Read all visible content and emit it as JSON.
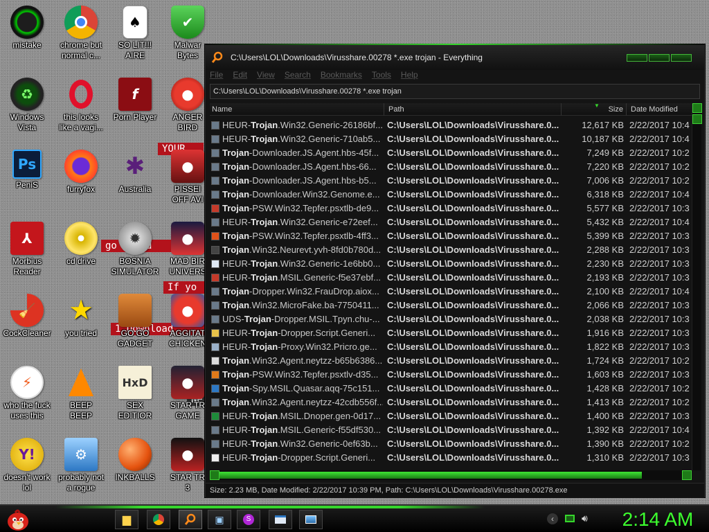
{
  "desktop": {
    "icons": [
      {
        "label": "mistake"
      },
      {
        "label": "chrome but\nnormal c..."
      },
      {
        "label": "SO LIT!!!\nAIRE"
      },
      {
        "label": "Malwar\nBytes"
      },
      {
        "label": "Windows\nVista"
      },
      {
        "label": "this looks\nlike a vagi..."
      },
      {
        "label": "Porn Player"
      },
      {
        "label": "ANGER\nBIRD"
      },
      {
        "label": "PeniS"
      },
      {
        "label": "furryfox"
      },
      {
        "label": "Australia"
      },
      {
        "label": "PISSEI\nOFF AVI"
      },
      {
        "label": "Morbius\nReader"
      },
      {
        "label": "cd drive"
      },
      {
        "label": "BOSNIA\nSIMULATOR"
      },
      {
        "label": "MAD BIR\nUNIVERS"
      },
      {
        "label": "CockCleaner"
      },
      {
        "label": "you tried"
      },
      {
        "label": "GO GO\nGADGET"
      },
      {
        "label": "AGGITAT\nCHICKEN"
      },
      {
        "label": "who the fuck\nuses this"
      },
      {
        "label": "BEEP\nBEEP"
      },
      {
        "label": "SEX\nEDITIOR"
      },
      {
        "label": "STAR TR\nGAME"
      },
      {
        "label": "doesn't work\nlol"
      },
      {
        "label": "probably not\na rogue"
      },
      {
        "label": "INKBALLS"
      },
      {
        "label": "STAR TR\n3"
      }
    ],
    "strips": [
      {
        "text": "YOUR"
      },
      {
        "text": "go   any   d"
      },
      {
        "text": "If yo"
      },
      {
        "text": "1  Download"
      },
      {
        "text": "Ne"
      }
    ]
  },
  "window": {
    "title": "C:\\Users\\LOL\\Downloads\\Virusshare.00278 *.exe trojan - Everything",
    "menu": [
      "File",
      "Edit",
      "View",
      "Search",
      "Bookmarks",
      "Tools",
      "Help"
    ],
    "search_value": "C:\\Users\\LOL\\Downloads\\Virusshare.00278 *.exe trojan",
    "columns": {
      "name": "Name",
      "path": "Path",
      "size": "Size",
      "date": "Date Modified"
    },
    "rows": [
      {
        "pre": "HEUR-",
        "hl": "Trojan",
        "post": ".Win32.Generic-26186bf...",
        "path": "C:\\Users\\LOL\\Downloads\\Virusshare.0...",
        "size": "12,617 KB",
        "date": "2/22/2017 10:4"
      },
      {
        "pre": "HEUR-",
        "hl": "Trojan",
        "post": ".Win32.Generic-710ab5...",
        "path": "C:\\Users\\LOL\\Downloads\\Virusshare.0...",
        "size": "10,187 KB",
        "date": "2/22/2017 10:4"
      },
      {
        "pre": "",
        "hl": "Trojan",
        "post": "-Downloader.JS.Agent.hbs-45f...",
        "path": "C:\\Users\\LOL\\Downloads\\Virusshare.0...",
        "size": "7,249 KB",
        "date": "2/22/2017 10:2"
      },
      {
        "pre": "",
        "hl": "Trojan",
        "post": "-Downloader.JS.Agent.hbs-66...",
        "path": "C:\\Users\\LOL\\Downloads\\Virusshare.0...",
        "size": "7,220 KB",
        "date": "2/22/2017 10:2"
      },
      {
        "pre": "",
        "hl": "Trojan",
        "post": "-Downloader.JS.Agent.hbs-b5...",
        "path": "C:\\Users\\LOL\\Downloads\\Virusshare.0...",
        "size": "7,006 KB",
        "date": "2/22/2017 10:2"
      },
      {
        "pre": "",
        "hl": "Trojan",
        "post": "-Downloader.Win32.Genome.e...",
        "path": "C:\\Users\\LOL\\Downloads\\Virusshare.0...",
        "size": "6,318 KB",
        "date": "2/22/2017 10:4"
      },
      {
        "pre": "",
        "hl": "Trojan",
        "post": "-PSW.Win32.Tepfer.psxtlb-de9...",
        "path": "C:\\Users\\LOL\\Downloads\\Virusshare.0...",
        "size": "5,577 KB",
        "date": "2/22/2017 10:3"
      },
      {
        "pre": "HEUR-",
        "hl": "Trojan",
        "post": ".Win32.Generic-e72eef...",
        "path": "C:\\Users\\LOL\\Downloads\\Virusshare.0...",
        "size": "5,432 KB",
        "date": "2/22/2017 10:4"
      },
      {
        "pre": "",
        "hl": "Trojan",
        "post": "-PSW.Win32.Tepfer.psxtlb-4ff3...",
        "path": "C:\\Users\\LOL\\Downloads\\Virusshare.0...",
        "size": "5,399 KB",
        "date": "2/22/2017 10:3"
      },
      {
        "pre": "",
        "hl": "Trojan",
        "post": ".Win32.Neurevt.yvh-8fd0b780d...",
        "path": "C:\\Users\\LOL\\Downloads\\Virusshare.0...",
        "size": "2,288 KB",
        "date": "2/22/2017 10:3"
      },
      {
        "pre": "HEUR-",
        "hl": "Trojan",
        "post": ".Win32.Generic-1e6bb0...",
        "path": "C:\\Users\\LOL\\Downloads\\Virusshare.0...",
        "size": "2,230 KB",
        "date": "2/22/2017 10:3"
      },
      {
        "pre": "HEUR-",
        "hl": "Trojan",
        "post": ".MSIL.Generic-f5e37ebf...",
        "path": "C:\\Users\\LOL\\Downloads\\Virusshare.0...",
        "size": "2,193 KB",
        "date": "2/22/2017 10:3"
      },
      {
        "pre": "",
        "hl": "Trojan",
        "post": "-Dropper.Win32.FrauDrop.aiox...",
        "path": "C:\\Users\\LOL\\Downloads\\Virusshare.0...",
        "size": "2,100 KB",
        "date": "2/22/2017 10:4"
      },
      {
        "pre": "",
        "hl": "Trojan",
        "post": ".Win32.MicroFake.ba-7750411...",
        "path": "C:\\Users\\LOL\\Downloads\\Virusshare.0...",
        "size": "2,066 KB",
        "date": "2/22/2017 10:3"
      },
      {
        "pre": "UDS-",
        "hl": "Trojan",
        "post": "-Dropper.MSIL.Tpyn.chu-...",
        "path": "C:\\Users\\LOL\\Downloads\\Virusshare.0...",
        "size": "2,038 KB",
        "date": "2/22/2017 10:3"
      },
      {
        "pre": "HEUR-",
        "hl": "Trojan",
        "post": "-Dropper.Script.Generi...",
        "path": "C:\\Users\\LOL\\Downloads\\Virusshare.0...",
        "size": "1,916 KB",
        "date": "2/22/2017 10:3"
      },
      {
        "pre": "HEUR-",
        "hl": "Trojan",
        "post": "-Proxy.Win32.Pricro.ge...",
        "path": "C:\\Users\\LOL\\Downloads\\Virusshare.0...",
        "size": "1,822 KB",
        "date": "2/22/2017 10:3"
      },
      {
        "pre": "",
        "hl": "Trojan",
        "post": ".Win32.Agent.neytzz-b65b6386...",
        "path": "C:\\Users\\LOL\\Downloads\\Virusshare.0...",
        "size": "1,724 KB",
        "date": "2/22/2017 10:2"
      },
      {
        "pre": "",
        "hl": "Trojan",
        "post": "-PSW.Win32.Tepfer.psxtlv-d35...",
        "path": "C:\\Users\\LOL\\Downloads\\Virusshare.0...",
        "size": "1,603 KB",
        "date": "2/22/2017 10:3"
      },
      {
        "pre": "",
        "hl": "Trojan",
        "post": "-Spy.MSIL.Quasar.aqq-75c151...",
        "path": "C:\\Users\\LOL\\Downloads\\Virusshare.0...",
        "size": "1,428 KB",
        "date": "2/22/2017 10:2"
      },
      {
        "pre": "",
        "hl": "Trojan",
        "post": ".Win32.Agent.neytzz-42cdb556f...",
        "path": "C:\\Users\\LOL\\Downloads\\Virusshare.0...",
        "size": "1,413 KB",
        "date": "2/22/2017 10:2"
      },
      {
        "pre": "HEUR-",
        "hl": "Trojan",
        "post": ".MSIL.Dnoper.gen-0d17...",
        "path": "C:\\Users\\LOL\\Downloads\\Virusshare.0...",
        "size": "1,400 KB",
        "date": "2/22/2017 10:3"
      },
      {
        "pre": "HEUR-",
        "hl": "Trojan",
        "post": ".MSIL.Generic-f55df530...",
        "path": "C:\\Users\\LOL\\Downloads\\Virusshare.0...",
        "size": "1,392 KB",
        "date": "2/22/2017 10:4"
      },
      {
        "pre": "HEUR-",
        "hl": "Trojan",
        "post": ".Win32.Generic-0ef63b...",
        "path": "C:\\Users\\LOL\\Downloads\\Virusshare.0...",
        "size": "1,390 KB",
        "date": "2/22/2017 10:2"
      },
      {
        "pre": "HEUR-",
        "hl": "Trojan",
        "post": "-Dropper.Script.Generi...",
        "path": "C:\\Users\\LOL\\Downloads\\Virusshare.0...",
        "size": "1,310 KB",
        "date": "2/22/2017 10:3"
      }
    ],
    "status": "Size: 2.23 MB, Date Modified: 2/22/2017 10:39 PM, Path: C:\\Users\\LOL\\Downloads\\Virusshare.00278.exe"
  },
  "taskbar": {
    "clock": "2:14 AM",
    "items": [
      "folder-icon",
      "chrome-icon",
      "everything-search-icon",
      "network-icon",
      "purple-app-icon",
      "window-icon",
      "image-viewer-icon"
    ]
  },
  "colors": {
    "accent_green": "#36d62c",
    "clock_green": "#3cff2e",
    "window_bg": "#141414"
  }
}
